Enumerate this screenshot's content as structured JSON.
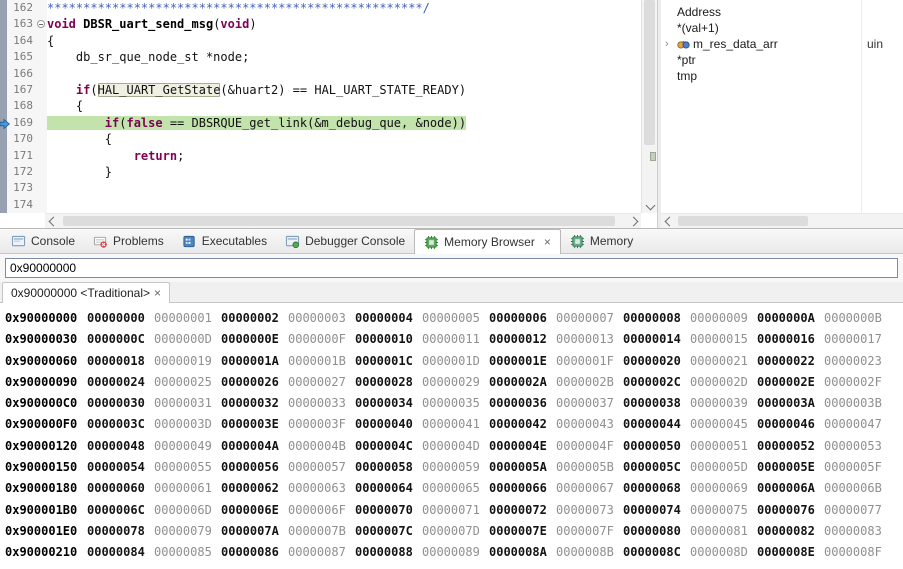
{
  "icons": {
    "close_glyph": "×",
    "expander_glyph": "›"
  },
  "editor": {
    "lines": [
      {
        "num": "162",
        "segs": [
          {
            "c": "cm",
            "t": "****************************************************/"
          }
        ]
      },
      {
        "num": "163",
        "fold": true,
        "segs": [
          {
            "c": "kw",
            "t": "void"
          },
          {
            "c": "pl",
            "t": " "
          },
          {
            "c": "fn",
            "t": "DBSR_uart_send_msg"
          },
          {
            "c": "pl",
            "t": "("
          },
          {
            "c": "kw",
            "t": "void"
          },
          {
            "c": "pl",
            "t": ")"
          }
        ]
      },
      {
        "num": "164",
        "segs": [
          {
            "c": "pl",
            "t": "{"
          }
        ]
      },
      {
        "num": "165",
        "segs": [
          {
            "c": "pl",
            "t": "    db_sr_que_node_st *node;"
          }
        ]
      },
      {
        "num": "166",
        "segs": []
      },
      {
        "num": "167",
        "segs": [
          {
            "c": "pl",
            "t": "    "
          },
          {
            "c": "kw",
            "t": "if"
          },
          {
            "c": "pl",
            "t": "("
          },
          {
            "c": "occ",
            "t": "HAL_UART_GetState"
          },
          {
            "c": "pl",
            "t": "(&huart2) == HAL_UART_STATE_READY)"
          }
        ]
      },
      {
        "num": "168",
        "segs": [
          {
            "c": "pl",
            "t": "    {"
          }
        ]
      },
      {
        "num": "169",
        "hl": true,
        "segs": [
          {
            "c": "pl",
            "t": "        "
          },
          {
            "c": "kw",
            "t": "if"
          },
          {
            "c": "pl",
            "t": "("
          },
          {
            "c": "kw",
            "t": "false"
          },
          {
            "c": "pl",
            "t": " == DBSRQUE_get_link(&m_debug_que, &node))"
          }
        ]
      },
      {
        "num": "170",
        "segs": [
          {
            "c": "pl",
            "t": "        {"
          }
        ]
      },
      {
        "num": "171",
        "segs": [
          {
            "c": "pl",
            "t": "            "
          },
          {
            "c": "kw",
            "t": "return"
          },
          {
            "c": "pl",
            "t": ";"
          }
        ]
      },
      {
        "num": "172",
        "segs": [
          {
            "c": "pl",
            "t": "        }"
          }
        ]
      },
      {
        "num": "173",
        "segs": []
      },
      {
        "num": "174",
        "segs": []
      }
    ]
  },
  "expressions": {
    "rows": [
      {
        "label": "Address"
      },
      {
        "label": "*(val+1)"
      },
      {
        "label": "m_res_data_arr",
        "expandable": true,
        "type": "uin"
      },
      {
        "label": "*ptr"
      },
      {
        "label": "tmp"
      }
    ]
  },
  "bottom_panel": {
    "tabs": [
      {
        "label": "Console",
        "icon": "console-icon"
      },
      {
        "label": "Problems",
        "icon": "problems-icon"
      },
      {
        "label": "Executables",
        "icon": "executables-icon"
      },
      {
        "label": "Debugger Console",
        "icon": "debugger-console-icon"
      },
      {
        "label": "Memory Browser",
        "icon": "memory-browser-icon",
        "active": true,
        "closable": true
      },
      {
        "label": "Memory",
        "icon": "memory-icon"
      }
    ]
  },
  "memory_browser": {
    "address_input": "0x90000000",
    "rendering_tab_label": "0x90000000 <Traditional>",
    "dump_rows": [
      {
        "addr": "0x90000000",
        "values": [
          "00000000",
          "00000001",
          "00000002",
          "00000003",
          "00000004",
          "00000005",
          "00000006",
          "00000007",
          "00000008",
          "00000009",
          "0000000A",
          "0000000B"
        ]
      },
      {
        "addr": "0x90000030",
        "values": [
          "0000000C",
          "0000000D",
          "0000000E",
          "0000000F",
          "00000010",
          "00000011",
          "00000012",
          "00000013",
          "00000014",
          "00000015",
          "00000016",
          "00000017"
        ]
      },
      {
        "addr": "0x90000060",
        "values": [
          "00000018",
          "00000019",
          "0000001A",
          "0000001B",
          "0000001C",
          "0000001D",
          "0000001E",
          "0000001F",
          "00000020",
          "00000021",
          "00000022",
          "00000023"
        ]
      },
      {
        "addr": "0x90000090",
        "values": [
          "00000024",
          "00000025",
          "00000026",
          "00000027",
          "00000028",
          "00000029",
          "0000002A",
          "0000002B",
          "0000002C",
          "0000002D",
          "0000002E",
          "0000002F"
        ]
      },
      {
        "addr": "0x900000C0",
        "values": [
          "00000030",
          "00000031",
          "00000032",
          "00000033",
          "00000034",
          "00000035",
          "00000036",
          "00000037",
          "00000038",
          "00000039",
          "0000003A",
          "0000003B"
        ]
      },
      {
        "addr": "0x900000F0",
        "values": [
          "0000003C",
          "0000003D",
          "0000003E",
          "0000003F",
          "00000040",
          "00000041",
          "00000042",
          "00000043",
          "00000044",
          "00000045",
          "00000046",
          "00000047"
        ]
      },
      {
        "addr": "0x90000120",
        "values": [
          "00000048",
          "00000049",
          "0000004A",
          "0000004B",
          "0000004C",
          "0000004D",
          "0000004E",
          "0000004F",
          "00000050",
          "00000051",
          "00000052",
          "00000053"
        ]
      },
      {
        "addr": "0x90000150",
        "values": [
          "00000054",
          "00000055",
          "00000056",
          "00000057",
          "00000058",
          "00000059",
          "0000005A",
          "0000005B",
          "0000005C",
          "0000005D",
          "0000005E",
          "0000005F"
        ]
      },
      {
        "addr": "0x90000180",
        "values": [
          "00000060",
          "00000061",
          "00000062",
          "00000063",
          "00000064",
          "00000065",
          "00000066",
          "00000067",
          "00000068",
          "00000069",
          "0000006A",
          "0000006B"
        ]
      },
      {
        "addr": "0x900001B0",
        "values": [
          "0000006C",
          "0000006D",
          "0000006E",
          "0000006F",
          "00000070",
          "00000071",
          "00000072",
          "00000073",
          "00000074",
          "00000075",
          "00000076",
          "00000077"
        ]
      },
      {
        "addr": "0x900001E0",
        "values": [
          "00000078",
          "00000079",
          "0000007A",
          "0000007B",
          "0000007C",
          "0000007D",
          "0000007E",
          "0000007F",
          "00000080",
          "00000081",
          "00000082",
          "00000083"
        ]
      },
      {
        "addr": "0x90000210",
        "values": [
          "00000084",
          "00000085",
          "00000086",
          "00000087",
          "00000088",
          "00000089",
          "0000008A",
          "0000008B",
          "0000008C",
          "0000008D",
          "0000008E",
          "0000008F"
        ]
      }
    ]
  }
}
